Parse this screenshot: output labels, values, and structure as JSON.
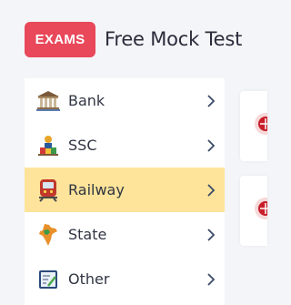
{
  "header": {
    "badge_label": "EXAMS",
    "title": "Free Mock Test"
  },
  "menu": {
    "items": [
      {
        "label": "Bank",
        "icon": "bank-building-icon",
        "active": false
      },
      {
        "label": "SSC",
        "icon": "ssc-emblem-icon",
        "active": false
      },
      {
        "label": "Railway",
        "icon": "train-icon",
        "active": true
      },
      {
        "label": "State",
        "icon": "india-map-icon",
        "active": false
      },
      {
        "label": "Other",
        "icon": "document-edit-icon",
        "active": false
      }
    ]
  },
  "colors": {
    "badge": "#e8485a",
    "active_item": "#fde49a",
    "chevron": "#3a4a66",
    "background": "#f3f5f8"
  }
}
